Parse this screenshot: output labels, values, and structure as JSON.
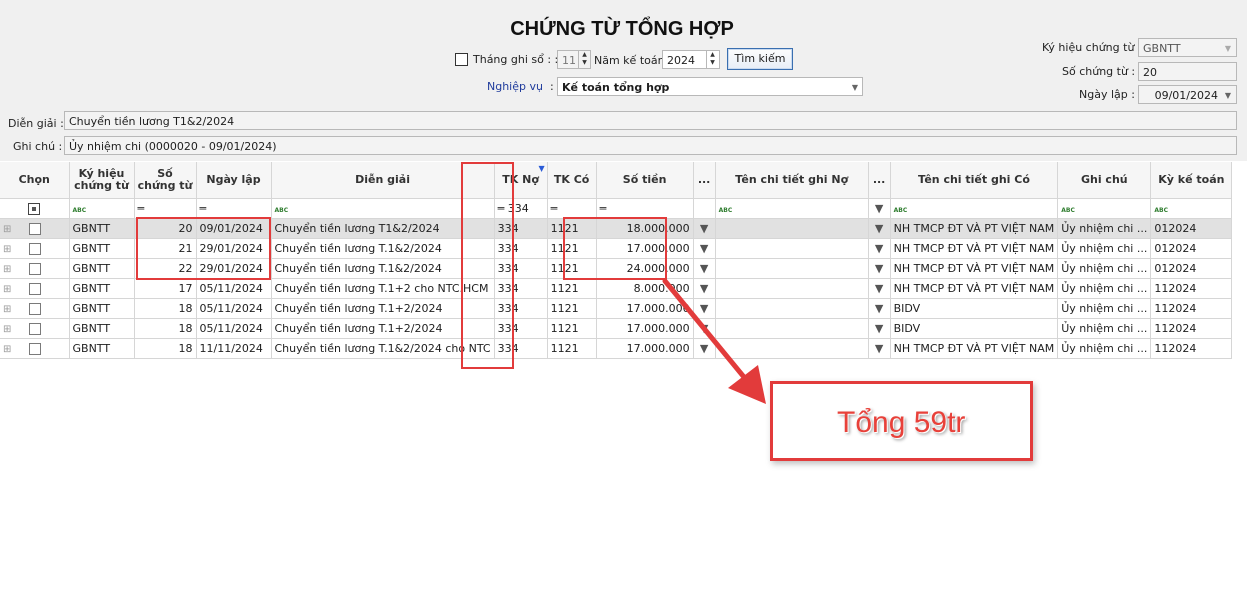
{
  "header": {
    "title": "CHỨNG TỪ TỔNG HỢP",
    "thang_ghi_so_label": "Tháng ghi sổ : :",
    "thang_ghi_so_value": "11",
    "nam_ke_toan_label": "Năm kế toán :",
    "nam_ke_toan_value": "2024",
    "search_button": "Tìm kiếm",
    "nghiep_vu_label": "Nghiệp vụ",
    "nghiep_vu_sep": ":",
    "nghiep_vu_value": "Kế toán tổng hợp",
    "ky_hieu_label": "Ký hiệu chứng từ :",
    "ky_hieu_value": "GBNTT",
    "so_chung_tu_label": "Số chứng từ :",
    "so_chung_tu_value": "20",
    "ngay_lap_label": "Ngày lập :",
    "ngay_lap_value": "09/01/2024",
    "dien_giai_label": "Diễn giải :",
    "dien_giai_value": "Chuyển tiền lương T1&2/2024",
    "ghi_chu_label": "Ghi chú :",
    "ghi_chu_value": "Ủy nhiệm chi (0000020 - 09/01/2024)"
  },
  "grid": {
    "columns": [
      "Chọn",
      "Ký hiệu chứng từ",
      "Số chứng từ",
      "Ngày lập",
      "Diễn giải",
      "TK Nợ",
      "TK Có",
      "Số tiền",
      "...",
      "Tên chi tiết ghi Nợ",
      "...",
      "Tên chi tiết ghi Có",
      "Ghi chú",
      "Kỳ kế toán"
    ],
    "filter": {
      "tk_no": "334"
    },
    "rows": [
      {
        "ky_hieu": "GBNTT",
        "so": "20",
        "ngay": "09/01/2024",
        "dien_giai": "Chuyển tiền lương T1&2/2024",
        "tk_no": "334",
        "tk_co": "1121",
        "so_tien": "18.000.000",
        "ghi_co": "NH TMCP ĐT VÀ PT VIỆT NAM",
        "ghi_chu": "Ủy nhiệm chi ...",
        "ky": "012024"
      },
      {
        "ky_hieu": "GBNTT",
        "so": "21",
        "ngay": "29/01/2024",
        "dien_giai": "Chuyển tiền lương T.1&2/2024",
        "tk_no": "334",
        "tk_co": "1121",
        "so_tien": "17.000.000",
        "ghi_co": "NH TMCP ĐT VÀ PT VIỆT NAM",
        "ghi_chu": "Ủy nhiệm chi ...",
        "ky": "012024"
      },
      {
        "ky_hieu": "GBNTT",
        "so": "22",
        "ngay": "29/01/2024",
        "dien_giai": "Chuyển tiền lương T.1&2/2024",
        "tk_no": "334",
        "tk_co": "1121",
        "so_tien": "24.000.000",
        "ghi_co": "NH TMCP ĐT VÀ PT VIỆT NAM",
        "ghi_chu": "Ủy nhiệm chi ...",
        "ky": "012024"
      },
      {
        "ky_hieu": "GBNTT",
        "so": "17",
        "ngay": "05/11/2024",
        "dien_giai": "Chuyển tiền lương T.1+2 cho NTC.HCM",
        "tk_no": "334",
        "tk_co": "1121",
        "so_tien": "8.000.000",
        "ghi_co": "NH TMCP ĐT VÀ PT VIỆT NAM",
        "ghi_chu": "Ủy nhiệm chi ...",
        "ky": "112024"
      },
      {
        "ky_hieu": "GBNTT",
        "so": "18",
        "ngay": "05/11/2024",
        "dien_giai": "Chuyển tiền lương T.1+2/2024",
        "tk_no": "334",
        "tk_co": "1121",
        "so_tien": "17.000.000",
        "ghi_co": "BIDV",
        "ghi_chu": "Ủy nhiệm chi ...",
        "ky": "112024"
      },
      {
        "ky_hieu": "GBNTT",
        "so": "18",
        "ngay": "05/11/2024",
        "dien_giai": "Chuyển tiền lương T.1+2/2024",
        "tk_no": "334",
        "tk_co": "1121",
        "so_tien": "17.000.000",
        "ghi_co": "BIDV",
        "ghi_chu": "Ủy nhiệm chi ...",
        "ky": "112024"
      },
      {
        "ky_hieu": "GBNTT",
        "so": "18",
        "ngay": "11/11/2024",
        "dien_giai": "Chuyển tiền lương T.1&2/2024 cho NTC",
        "tk_no": "334",
        "tk_co": "1121",
        "so_tien": "17.000.000",
        "ghi_co": "NH TMCP ĐT VÀ PT VIỆT NAM",
        "ghi_chu": "Ủy nhiệm chi ...",
        "ky": "112024"
      }
    ]
  },
  "annotation": {
    "text": "Tổng 59tr",
    "color": "#e23b3b"
  },
  "icons": {
    "expand": "plus-expand-icon",
    "filter_text": "abc-filter-icon",
    "filter_equals": "equals-filter-icon",
    "dropdown": "chevron-down-icon",
    "column_filter": "funnel-icon"
  }
}
